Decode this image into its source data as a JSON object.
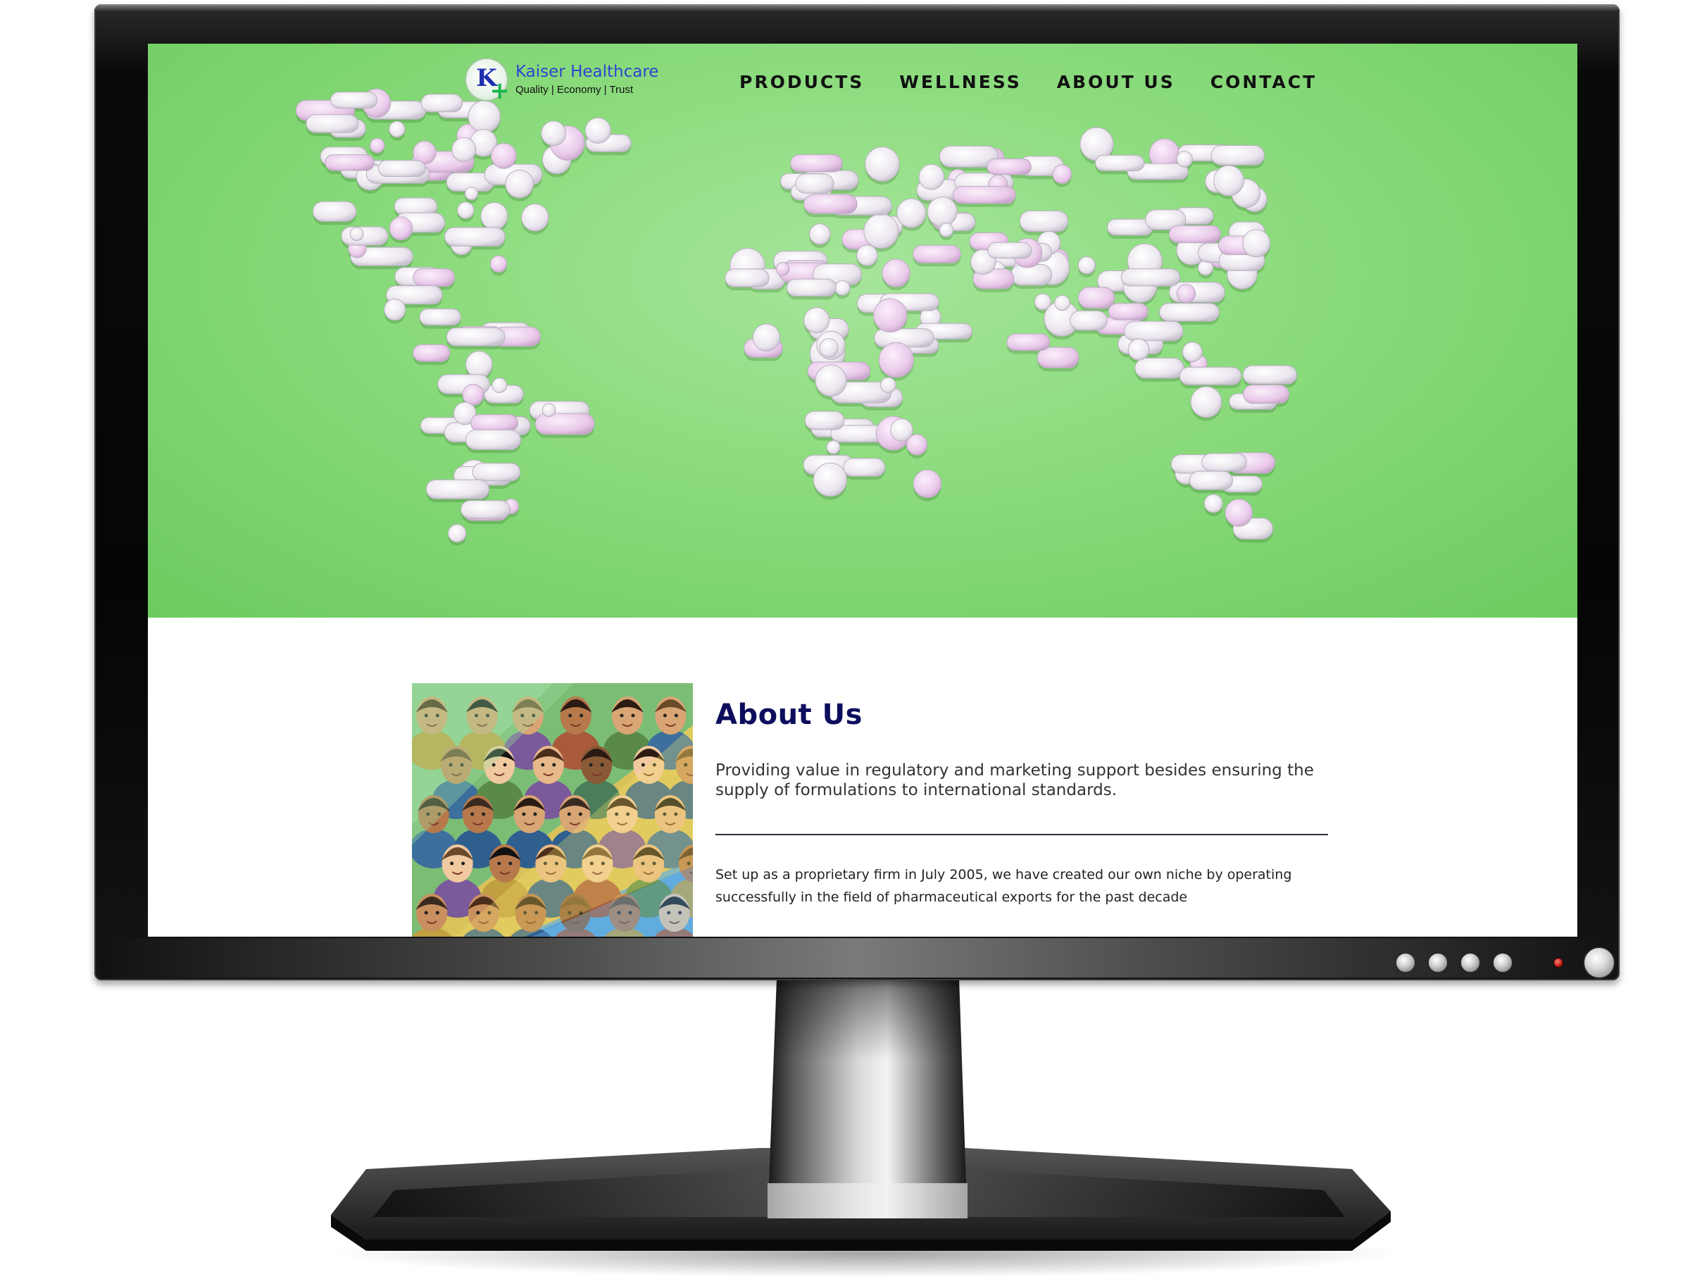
{
  "site": {
    "logo": {
      "initial": "K",
      "plus": "+",
      "name": "Kaiser Healthcare",
      "tagline": "Quality | Economy | Trust"
    },
    "nav": [
      {
        "label": "PRODUCTS"
      },
      {
        "label": "WELLNESS"
      },
      {
        "label": "ABOUT US"
      },
      {
        "label": "CONTACT"
      }
    ],
    "hero": {
      "image": "world map made of white and pink pills on a green background"
    },
    "about": {
      "title": "About Us",
      "lead": "Providing value in regulatory and marketing support besides ensuring the supply of formulations to international standards.",
      "body": "Set up as a proprietary firm in July 2005, we have created our own niche by operating successfully in the field of pharmaceutical exports for the past decade",
      "image": "illustrated crowd of diverse people faces"
    }
  },
  "colors": {
    "hero_green": "#8ddc7f",
    "heading_navy": "#0d0d5e",
    "logo_blue": "#2e44d0",
    "logo_green": "#19b64a"
  },
  "monitor": {
    "bezel_buttons": [
      "button-icon",
      "button-icon",
      "button-icon",
      "button-icon"
    ],
    "led": "red-power-led",
    "power": "power-button-icon"
  }
}
